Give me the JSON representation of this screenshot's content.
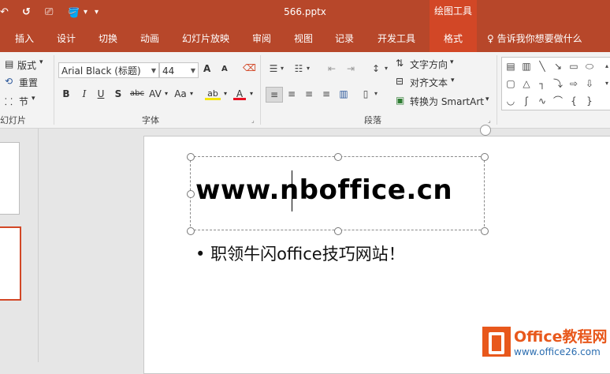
{
  "qat": {
    "back": "↶",
    "undo": "↺",
    "present": "⎚",
    "paint": "🪣",
    "more": "▾"
  },
  "title": {
    "file": "566.pptx",
    "context_tools": "绘图工具"
  },
  "tabs": [
    "插入",
    "设计",
    "切换",
    "动画",
    "幻灯片放映",
    "审阅",
    "视图",
    "记录",
    "开发工具",
    "格式"
  ],
  "tell_me": "告诉我你想要做什么",
  "slides_group": {
    "layout": "版式",
    "reset": "重置",
    "section": "节",
    "label": "幻灯片"
  },
  "font_group": {
    "font": "Arial Black (标题)",
    "size": "44",
    "label": "字体",
    "grow": "A",
    "shrink": "A",
    "bold": "B",
    "italic": "I",
    "underline": "U",
    "shadow": "S",
    "strike": "abc",
    "spacing": "AV",
    "case": "Aa",
    "highlight": "ab",
    "color": "A"
  },
  "paragraph_group": {
    "label": "段落",
    "text_direction": "文字方向",
    "align_text": "对齐文本",
    "smartart": "转换为 SmartArt"
  },
  "slide": {
    "title": "www.nboffice.cn",
    "bullet": "职领牛闪office技巧网站！"
  },
  "watermark": {
    "brand": "Office教程网",
    "url": "www.office26.com"
  },
  "colors": {
    "accent": "#b7472a",
    "context": "#d24726"
  }
}
